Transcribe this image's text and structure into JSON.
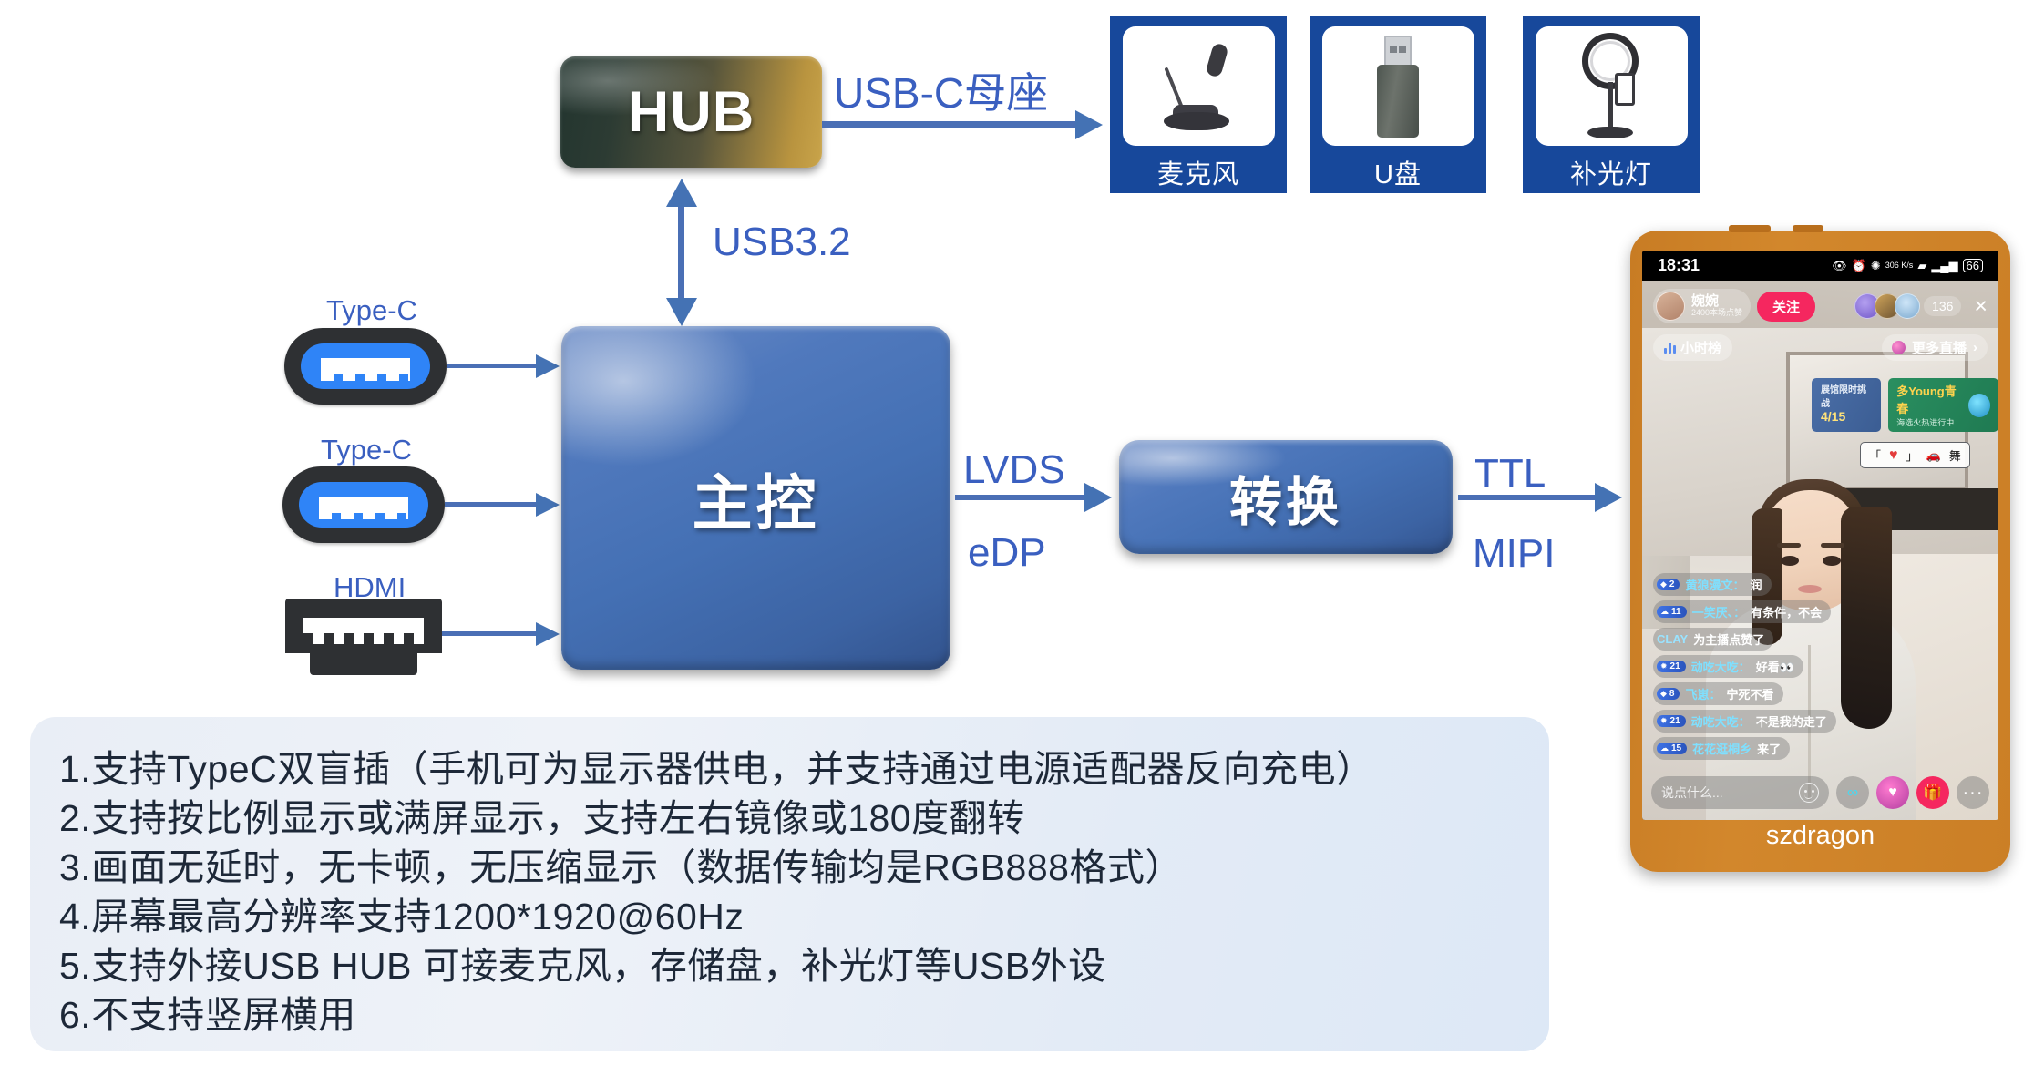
{
  "diagram": {
    "hub": {
      "label": "HUB"
    },
    "mcu": {
      "label": "主控"
    },
    "converter": {
      "label": "转换"
    },
    "connections": {
      "hub_to_peripherals": "USB-C母座",
      "hub_to_mcu": "USB3.2",
      "mcu_to_converter_1": "LVDS",
      "mcu_to_converter_2": "eDP",
      "converter_to_screen_1": "TTL",
      "converter_to_screen_2": "MIPI"
    },
    "inputs": [
      {
        "label": "Type-C",
        "icon": "usb-type-c-port-icon"
      },
      {
        "label": "Type-C",
        "icon": "usb-type-c-port-icon"
      },
      {
        "label": "HDMI",
        "icon": "hdmi-port-icon"
      }
    ],
    "peripherals": [
      {
        "label": "麦克风",
        "icon": "microphone-icon"
      },
      {
        "label": "U盘",
        "icon": "usb-flash-drive-icon"
      },
      {
        "label": "补光灯",
        "icon": "ring-light-icon"
      }
    ]
  },
  "specs": {
    "lines": [
      "1.支持TypeC双盲插（手机可为显示器供电，并支持通过电源适配器反向充电）",
      "2.支持按比例显示或满屏显示，支持左右镜像或180度翻转",
      "3.画面无延时，无卡顿，无压缩显示（数据传输均是RGB888格式）",
      "4.屏幕最高分辨率支持1200*1920@60Hz",
      "5.支持外接USB HUB 可接麦克风，存储盘，补光灯等USB外设",
      "6.不支持竖屏横用"
    ]
  },
  "phone": {
    "caption": "szdragon",
    "status_bar": {
      "time": "18:31",
      "network_speed": "306 K/s",
      "battery": "66"
    },
    "live": {
      "host_name": "婉婉",
      "host_sub": "2400本场点赞",
      "follow_button": "关注",
      "viewer_count": "136",
      "close_label": "×",
      "rank_chip": "小时榜",
      "more_live": "更多直播",
      "more_live_arrow": "›",
      "banner_blue_title": "展馆限时挑战",
      "banner_blue_value": "4/15",
      "banner_green_title": "多Young青春",
      "banner_green_sub": "海选火热进行中",
      "bubble_text": "舞",
      "chat_input_placeholder": "说点什么...",
      "messages": [
        {
          "level": "2",
          "user": "黄狼漫文：",
          "text": "润"
        },
        {
          "level": "11",
          "user": "一笑厌、：",
          "text": "有条件，不会"
        },
        {
          "level": "",
          "user": "CLAY",
          "text": "为主播点赞了"
        },
        {
          "level": "21",
          "user": "动吃大吃：",
          "text": "好看👀"
        },
        {
          "level": "8",
          "user": "飞崽：",
          "text": "宁死不看"
        },
        {
          "level": "21",
          "user": "动吃大吃：",
          "text": "不是我的走了"
        },
        {
          "level": "15",
          "user": "花花逛桐乡",
          "text": "来了"
        }
      ]
    }
  },
  "colors": {
    "accent_blue": "#3a5fc0",
    "arrow_blue": "#4472b4",
    "card_blue": "#17489b",
    "panel_bg": "#e9eef6",
    "phone_frame": "#c87c24"
  }
}
